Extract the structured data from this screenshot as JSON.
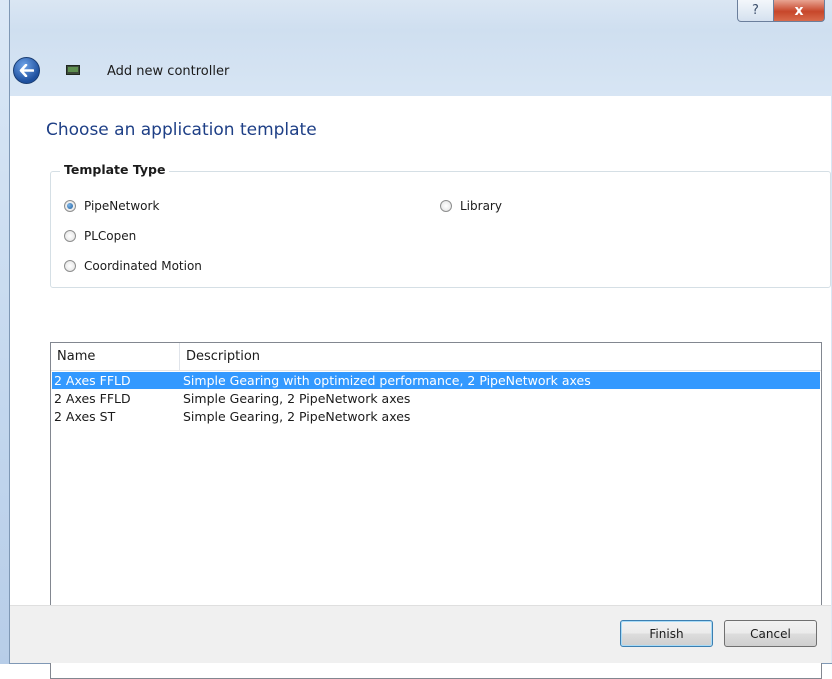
{
  "window": {
    "help_label": "?",
    "close_label": "x"
  },
  "header": {
    "title": "Add new controller",
    "back_icon": "back-arrow-icon",
    "app_icon": "controller-icon"
  },
  "page": {
    "title": "Choose an application template"
  },
  "template_type": {
    "legend": "Template Type",
    "options": [
      {
        "label": "PipeNetwork",
        "selected": true
      },
      {
        "label": "Library",
        "selected": false
      },
      {
        "label": "PLCopen",
        "selected": false
      },
      {
        "label": "Coordinated Motion",
        "selected": false
      }
    ]
  },
  "templates": {
    "columns": [
      "Name",
      "Description"
    ],
    "rows": [
      {
        "name": "2 Axes FFLD",
        "description": "Simple Gearing with optimized performance, 2 PipeNetwork axes",
        "selected": true
      },
      {
        "name": "2 Axes FFLD",
        "description": "Simple Gearing, 2 PipeNetwork axes",
        "selected": false
      },
      {
        "name": "2 Axes ST",
        "description": "Simple Gearing, 2 PipeNetwork axes",
        "selected": false
      }
    ]
  },
  "footer": {
    "finish_label": "Finish",
    "cancel_label": "Cancel"
  },
  "colors": {
    "selection": "#3399ff",
    "title_blue": "#1e3f86"
  }
}
